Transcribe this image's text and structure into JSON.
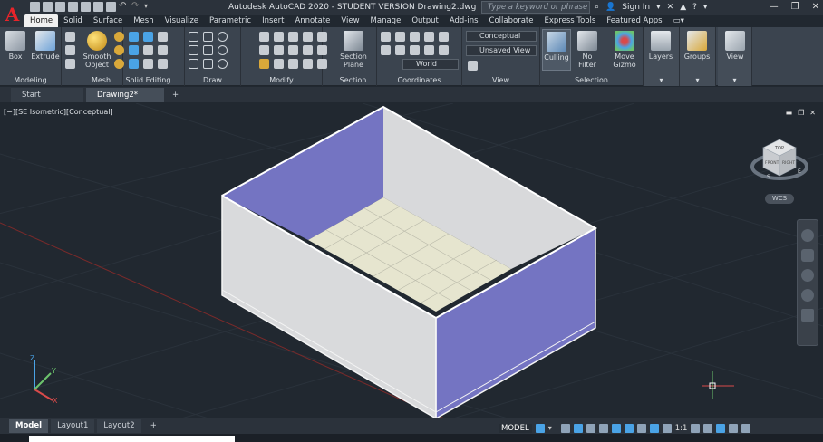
{
  "app": {
    "title": "Autodesk AutoCAD 2020 - STUDENT VERSION    Drawing2.dwg",
    "logo_letter": "A",
    "search_placeholder": "Type a keyword or phrase",
    "sign_in": "Sign In"
  },
  "ribbon_tabs": [
    "Home",
    "Solid",
    "Surface",
    "Mesh",
    "Visualize",
    "Parametric",
    "Insert",
    "Annotate",
    "View",
    "Manage",
    "Output",
    "Add-ins",
    "Collaborate",
    "Express Tools",
    "Featured Apps"
  ],
  "ribbon": {
    "box_label": "Box",
    "extrude_label": "Extrude",
    "smooth_label": "Smooth Object",
    "section_plane_label": "Section Plane",
    "culling_label": "Culling",
    "no_filter_label": "No Filter",
    "move_gizmo_label": "Move Gizmo",
    "layers_label": "Layers",
    "groups_label": "Groups",
    "view_btn_label": "View",
    "visual_style": "Conceptual",
    "named_view": "Unsaved View",
    "ucs": "World",
    "panels": {
      "modeling": "Modeling",
      "mesh": "Mesh",
      "solid_editing": "Solid Editing",
      "draw": "Draw",
      "modify": "Modify",
      "section": "Section",
      "coordinates": "Coordinates",
      "view": "View",
      "selection": "Selection"
    }
  },
  "file_tabs": [
    "Start",
    "Drawing2*"
  ],
  "viewport": {
    "label": "[−][SE Isometric][Conceptual]",
    "wcs": "WCS",
    "viewcube_faces": {
      "top": "TOP",
      "front": "FRONT",
      "right": "RIGHT"
    },
    "compass": {
      "s": "S",
      "e": "E"
    },
    "ucs_axes": {
      "x": "X",
      "y": "Y",
      "z": "Z"
    }
  },
  "layout_tabs": [
    "Model",
    "Layout1",
    "Layout2"
  ],
  "status": {
    "model": "MODEL",
    "scale": "1:1"
  },
  "colors": {
    "background": "#212830",
    "ribbon": "#3b444f",
    "box_outer": "#d9dadc",
    "box_inner_wall": "#7474c2",
    "box_floor": "#e6e5cf",
    "accent": "#4aa3e6"
  }
}
